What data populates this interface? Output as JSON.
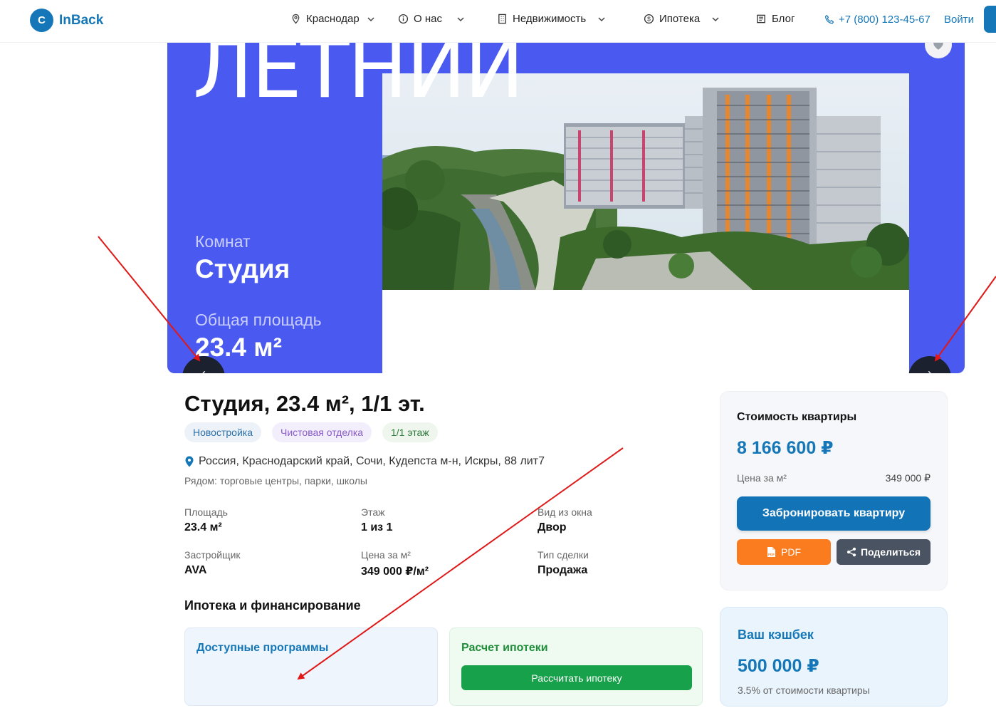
{
  "header": {
    "logo_letter": "C",
    "logo_text": "InBack",
    "city": "Краснодар",
    "nav": [
      "О нас",
      "Недвижимость",
      "Ипотека",
      "Блог"
    ],
    "phone": "+7 (800) 123-45-67",
    "login": "Войти"
  },
  "hero": {
    "banner_title": "ЛЕТНИИ",
    "rooms_label": "Комнат",
    "rooms_value": "Студия",
    "area_label": "Общая площадь",
    "area_value": "23.4 м²",
    "prev_label": "‹",
    "next_label": "›"
  },
  "listing": {
    "title": "Студия, 23.4 м², 1/1 эт.",
    "tags": [
      "Новостройка",
      "Чистовая отделка",
      "1/1 этаж"
    ],
    "address": "Россия, Краснодарский край, Сочи, Кудепста м-н, Искры, 88 лит7",
    "nearby": "Рядом: торговые центры, парки, школы",
    "props": [
      {
        "label": "Площадь",
        "value": "23.4 м²"
      },
      {
        "label": "Этаж",
        "value": "1 из 1"
      },
      {
        "label": "Вид из окна",
        "value": "Двор"
      },
      {
        "label": "Застройщик",
        "value": "AVA"
      },
      {
        "label": "Цена за м²",
        "value": "349 000 ₽/м²"
      },
      {
        "label": "Тип сделки",
        "value": "Продажа"
      }
    ],
    "mortgage_title": "Ипотека и финансирование",
    "programs_title": "Доступные программы",
    "calc_title": "Расчет ипотеки",
    "calc_button": "Рассчитать ипотеку"
  },
  "price_card": {
    "title": "Стоимость квартиры",
    "price": "8 166 600 ₽",
    "per_m2_label": "Цена за м²",
    "per_m2_value": "349 000 ₽",
    "book_button": "Забронировать квартиру",
    "pdf_button": "PDF",
    "share_button": "Поделиться"
  },
  "cashback": {
    "title": "Ваш кэшбек",
    "amount": "500 000 ₽",
    "note": "3.5% от стоимости квартиры"
  },
  "colors": {
    "brand": "#1577b8",
    "hero_bg": "#4a5af0",
    "pdf": "#fb7b1f",
    "share": "#4a5361",
    "calc": "#17a14a",
    "annotation": "#e01818"
  }
}
